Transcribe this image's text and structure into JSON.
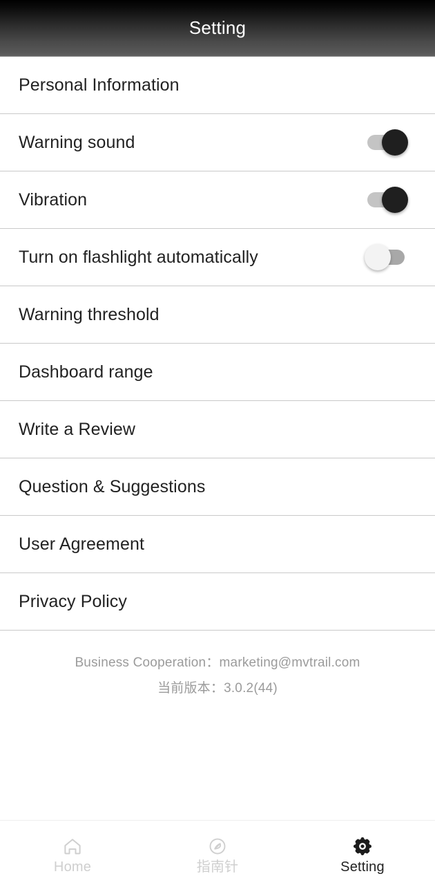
{
  "header": {
    "title": "Setting"
  },
  "settings": {
    "rows": [
      {
        "label": "Personal Information",
        "control": "none",
        "state": ""
      },
      {
        "label": "Warning sound",
        "control": "switch",
        "state": "on"
      },
      {
        "label": "Vibration",
        "control": "switch",
        "state": "on"
      },
      {
        "label": "Turn on flashlight automatically",
        "control": "switch",
        "state": "off"
      },
      {
        "label": "Warning threshold",
        "control": "none",
        "state": ""
      },
      {
        "label": "Dashboard range",
        "control": "none",
        "state": ""
      },
      {
        "label": "Write a Review",
        "control": "none",
        "state": ""
      },
      {
        "label": "Question & Suggestions",
        "control": "none",
        "state": ""
      },
      {
        "label": "User Agreement",
        "control": "none",
        "state": ""
      },
      {
        "label": "Privacy Policy",
        "control": "none",
        "state": ""
      }
    ]
  },
  "footer": {
    "business_cooperation": "Business Cooperation：marketing@mvtrail.com",
    "version": "当前版本：3.0.2(44)"
  },
  "bottom_nav": {
    "items": [
      {
        "label": "Home",
        "icon": "home-icon",
        "active": false
      },
      {
        "label": "指南针",
        "icon": "compass-icon",
        "active": false
      },
      {
        "label": "Setting",
        "icon": "gear-icon",
        "active": true
      }
    ]
  },
  "colors": {
    "divider": "#c9c9c9",
    "text_primary": "#222222",
    "text_muted": "#9b9b9b",
    "nav_inactive": "#cfcfcf",
    "switch_on_thumb": "#1f1f1f",
    "switch_on_track": "#c4c4c4",
    "switch_off_thumb": "#f3f3f3",
    "switch_off_track": "#a8a8a8"
  }
}
